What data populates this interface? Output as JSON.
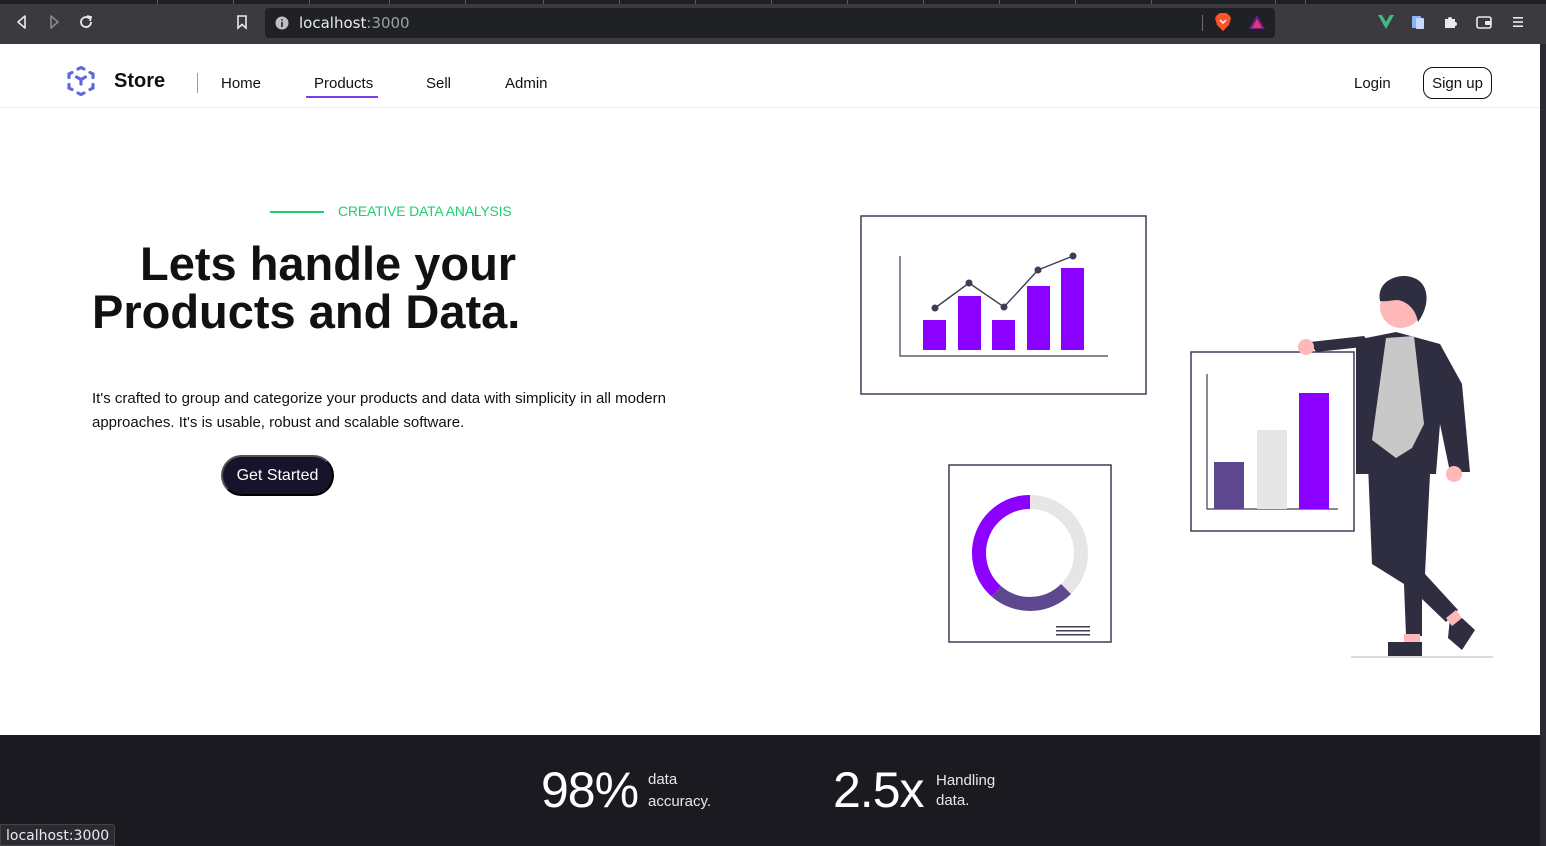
{
  "browser": {
    "url_host": "localhost",
    "url_port": ":3000",
    "status_url": "localhost:3000"
  },
  "nav": {
    "brand": "Store",
    "links": [
      "Home",
      "Products",
      "Sell",
      "Admin"
    ],
    "active": "Products",
    "login": "Login",
    "signup": "Sign up"
  },
  "hero": {
    "eyebrow": "CREATIVE DATA ANALYSIS",
    "title_line1": "Lets handle your",
    "title_line2": "Products and Data.",
    "description": "It's crafted to group and categorize your products and data with simplicity in all modern approaches. It's is usable, robust and scalable software.",
    "cta": "Get Started"
  },
  "stats": [
    {
      "value": "98%",
      "label_line1": "data",
      "label_line2": "accuracy."
    },
    {
      "value": "2.5x",
      "label_line1": "Handling",
      "label_line2": "data."
    }
  ],
  "colors": {
    "accent_purple": "#8c00ff",
    "muted_purple": "#5d478e",
    "green": "#1fcf6e",
    "dark": "#16132a"
  }
}
